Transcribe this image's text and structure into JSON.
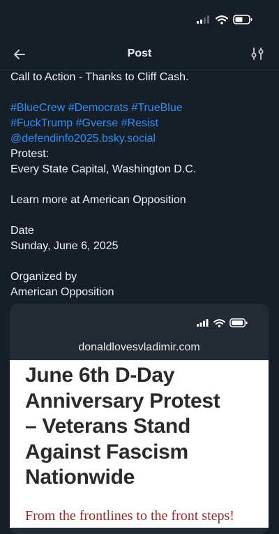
{
  "header": {
    "title": "Post"
  },
  "post": {
    "lines": [
      "Call to Action - Thanks to Cliff Cash."
    ],
    "hashtags_line1": "#BlueCrew #Democrats #TrueBlue",
    "hashtags_line2": "#FuckTrump #Gverse #Resist",
    "mention": "@defendinfo2025.bsky.social",
    "protest_label": "Protest:",
    "protest_location": "Every State Capital, Washington D.C.",
    "learn_more": "Learn more at American Opposition",
    "date_label": "Date",
    "date_value": "Sunday, June 6, 2025",
    "organized_label": "Organized by",
    "organized_value": "American Opposition"
  },
  "embed": {
    "url": "donaldlovesvladimir.com",
    "headline_lines": [
      "June 6th D-Day",
      "Anniversary Protest",
      "– Veterans Stand",
      "Against Fascism",
      "Nationwide"
    ],
    "subline": "From the frontlines to the front steps!"
  },
  "colors": {
    "background": "#161e27",
    "link": "#2f8ef5",
    "accent_red": "#9b2a2a"
  },
  "icons": {
    "back": "arrow-left-icon",
    "filter": "sliders-icon",
    "signal": "cellular-signal-icon",
    "wifi": "wifi-icon",
    "battery": "battery-icon"
  }
}
